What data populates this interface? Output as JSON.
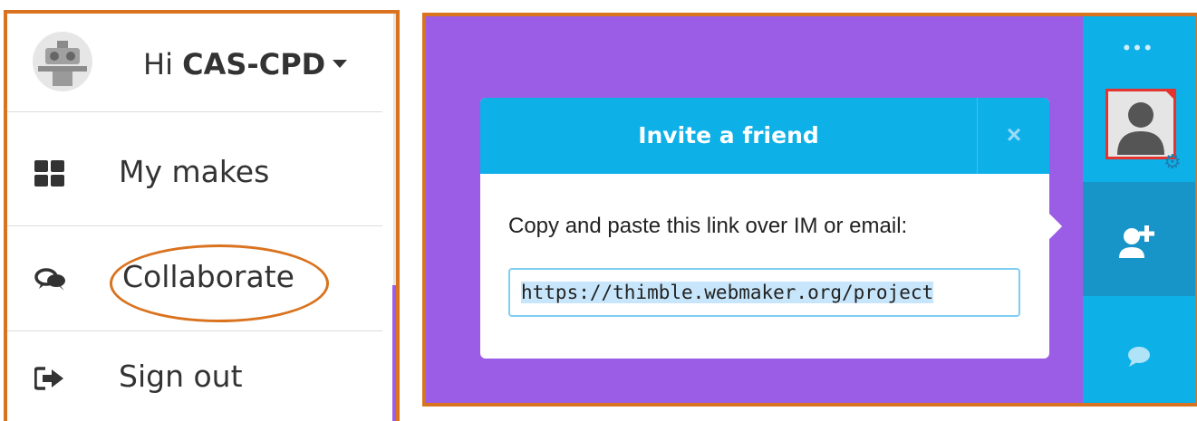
{
  "user_menu": {
    "greeting_prefix": "Hi",
    "username": "CAS-CPD",
    "items": [
      {
        "label": "My makes",
        "icon": "grid-icon"
      },
      {
        "label": "Collaborate",
        "icon": "chat-bubbles-icon"
      },
      {
        "label": "Sign out",
        "icon": "sign-out-icon"
      }
    ]
  },
  "invite_popup": {
    "title": "Invite a friend",
    "close_label": "×",
    "instructions": "Copy and paste this link over IM or email:",
    "link_value": "https://thimble.webmaker.org/project"
  },
  "sidebar": {
    "menu_dots": "•••"
  },
  "colors": {
    "highlight_orange": "#d9731f",
    "purple_bg": "#9b5de5",
    "accent_blue": "#0eb0e8"
  }
}
